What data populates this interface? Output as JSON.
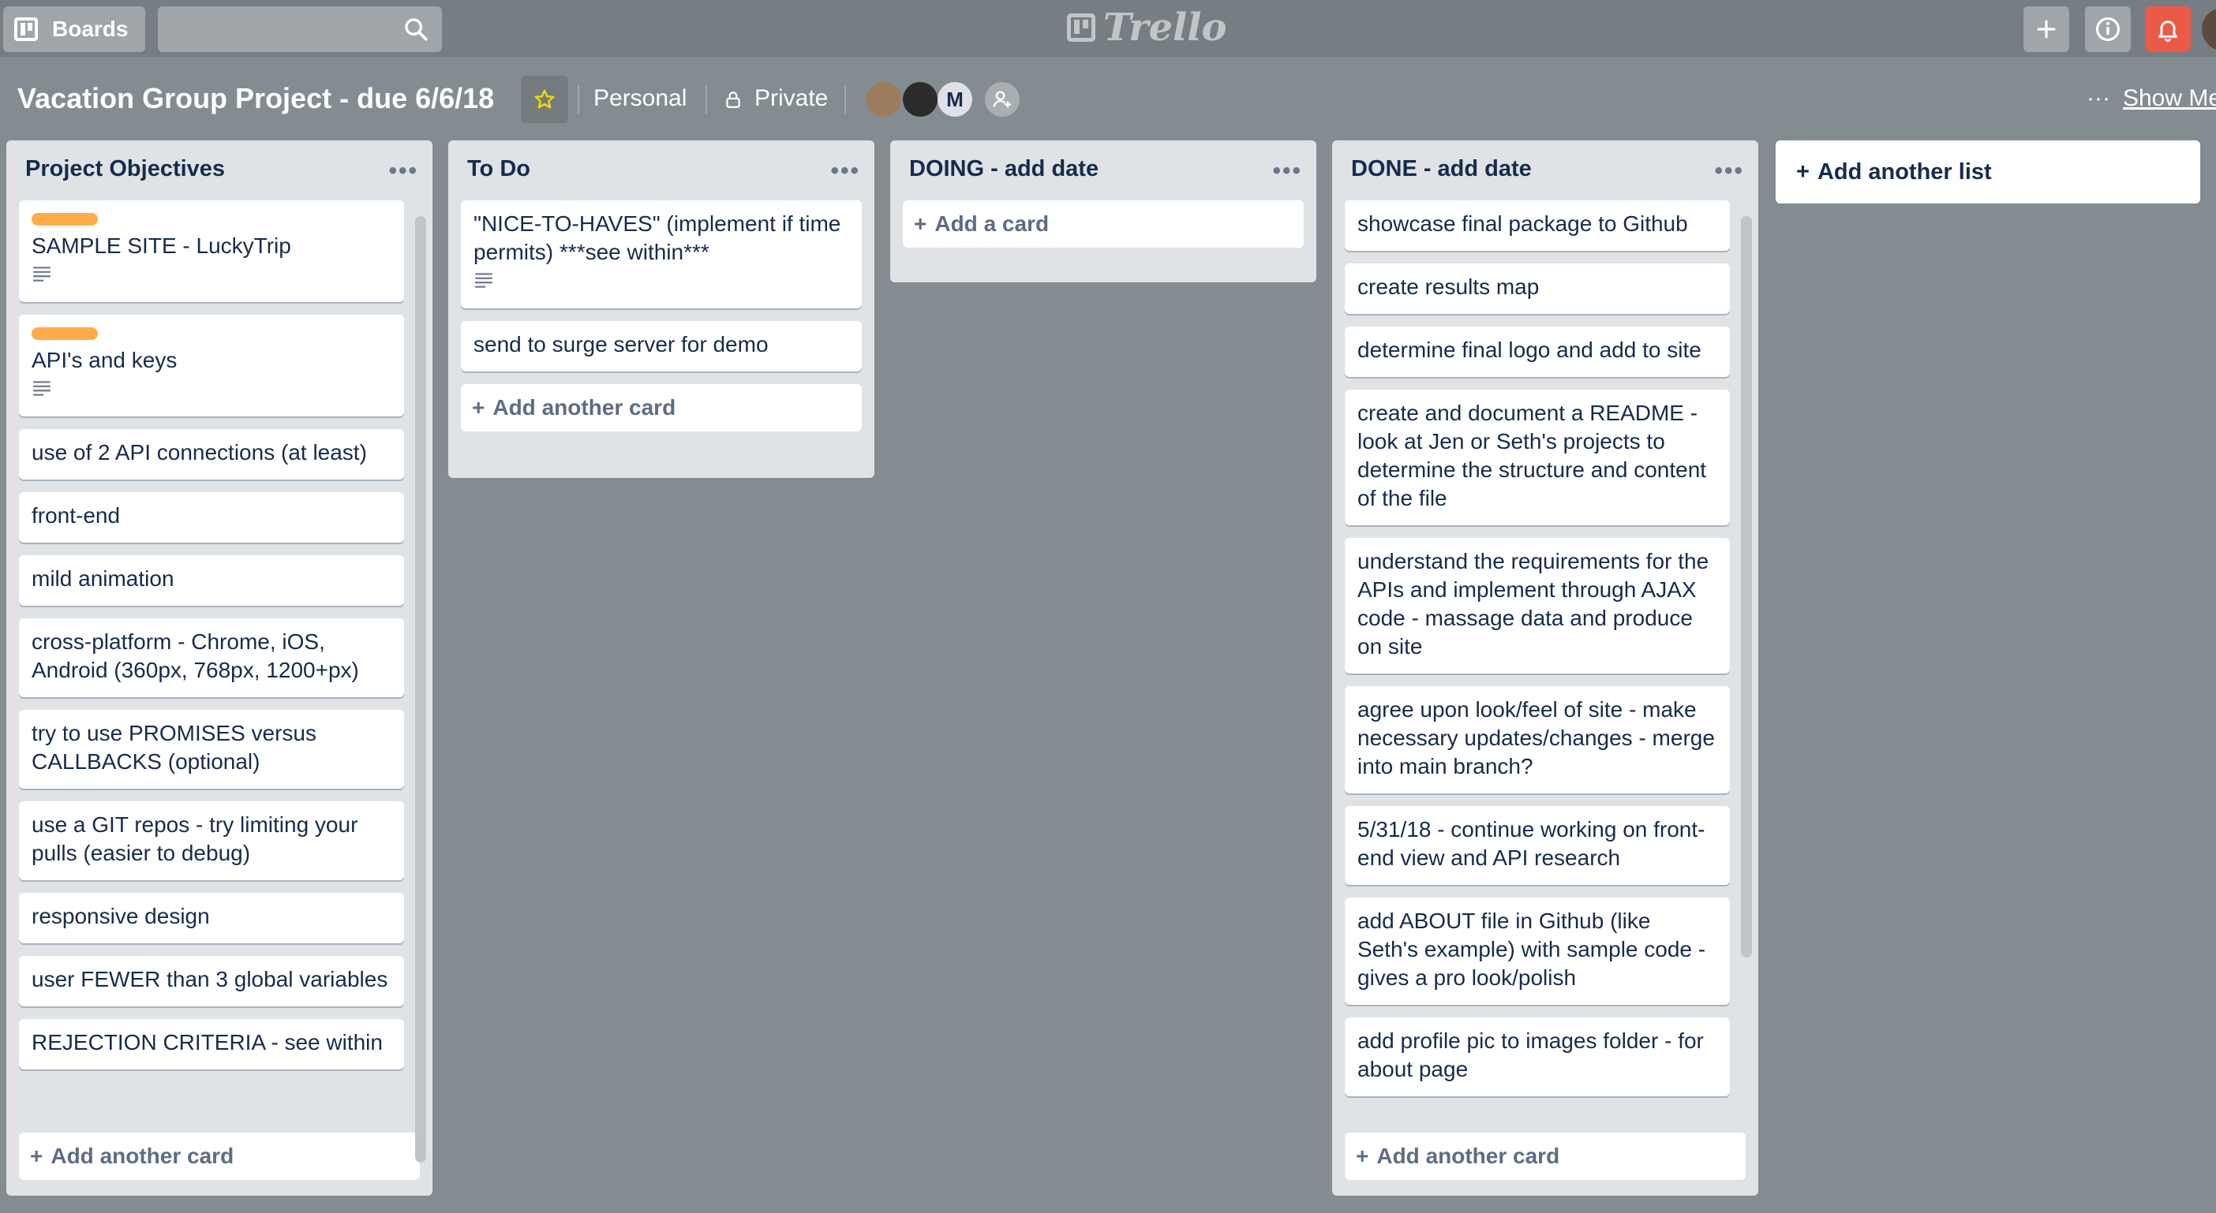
{
  "topbar": {
    "boards_label": "Boards",
    "logo_text": "Trello",
    "search_placeholder": ""
  },
  "board": {
    "title": "Vacation Group Project - due 6/6/18",
    "team": "Personal",
    "visibility": "Private",
    "member_initial": "M",
    "show_menu_label": "Show Me"
  },
  "lists": [
    {
      "title": "Project Objectives",
      "cards": [
        {
          "text": "SAMPLE SITE - LuckyTrip",
          "label": "orange",
          "has_description": true
        },
        {
          "text": "API's and keys",
          "label": "orange",
          "has_description": true
        },
        {
          "text": "use of 2 API connections (at least)"
        },
        {
          "text": "front-end"
        },
        {
          "text": "mild animation"
        },
        {
          "text": "cross-platform - Chrome, iOS, Android (360px, 768px, 1200+px)"
        },
        {
          "text": "try to use PROMISES versus CALLBACKS (optional)"
        },
        {
          "text": "use a GIT repos - try limiting your pulls (easier to debug)"
        },
        {
          "text": "responsive design"
        },
        {
          "text": "user FEWER than 3 global variables"
        },
        {
          "text": "REJECTION CRITERIA - see within"
        }
      ],
      "add_label": "Add another card"
    },
    {
      "title": "To Do",
      "cards": [
        {
          "text": "\"NICE-TO-HAVES\" (implement if time permits) ***see within***",
          "has_description": true
        },
        {
          "text": "send to surge server for demo"
        }
      ],
      "add_label": "Add another card"
    },
    {
      "title": "DOING - add date",
      "cards": [],
      "add_label": "Add a card"
    },
    {
      "title": "DONE - add date",
      "cards": [
        {
          "text": "showcase final package to Github"
        },
        {
          "text": "create results map"
        },
        {
          "text": "determine final logo and add to site"
        },
        {
          "text": "create and document a README - look at Jen or Seth's projects to determine the structure and content of the file"
        },
        {
          "text": "understand the requirements for the APIs and implement through AJAX code - massage data and produce on site"
        },
        {
          "text": "agree upon look/feel of site - make necessary updates/changes - merge into main branch?"
        },
        {
          "text": "5/31/18 - continue working on front-end view and API research"
        },
        {
          "text": "add ABOUT file in Github (like Seth's example) with sample code - gives a pro look/polish"
        },
        {
          "text": "add profile pic to images folder - for about page"
        }
      ],
      "add_label": "Add another card"
    }
  ],
  "add_list_label": "Add another list",
  "colors": {
    "board_bg": "#838c91",
    "label_orange": "#ffab4a",
    "notification_red": "#eb5a46"
  }
}
